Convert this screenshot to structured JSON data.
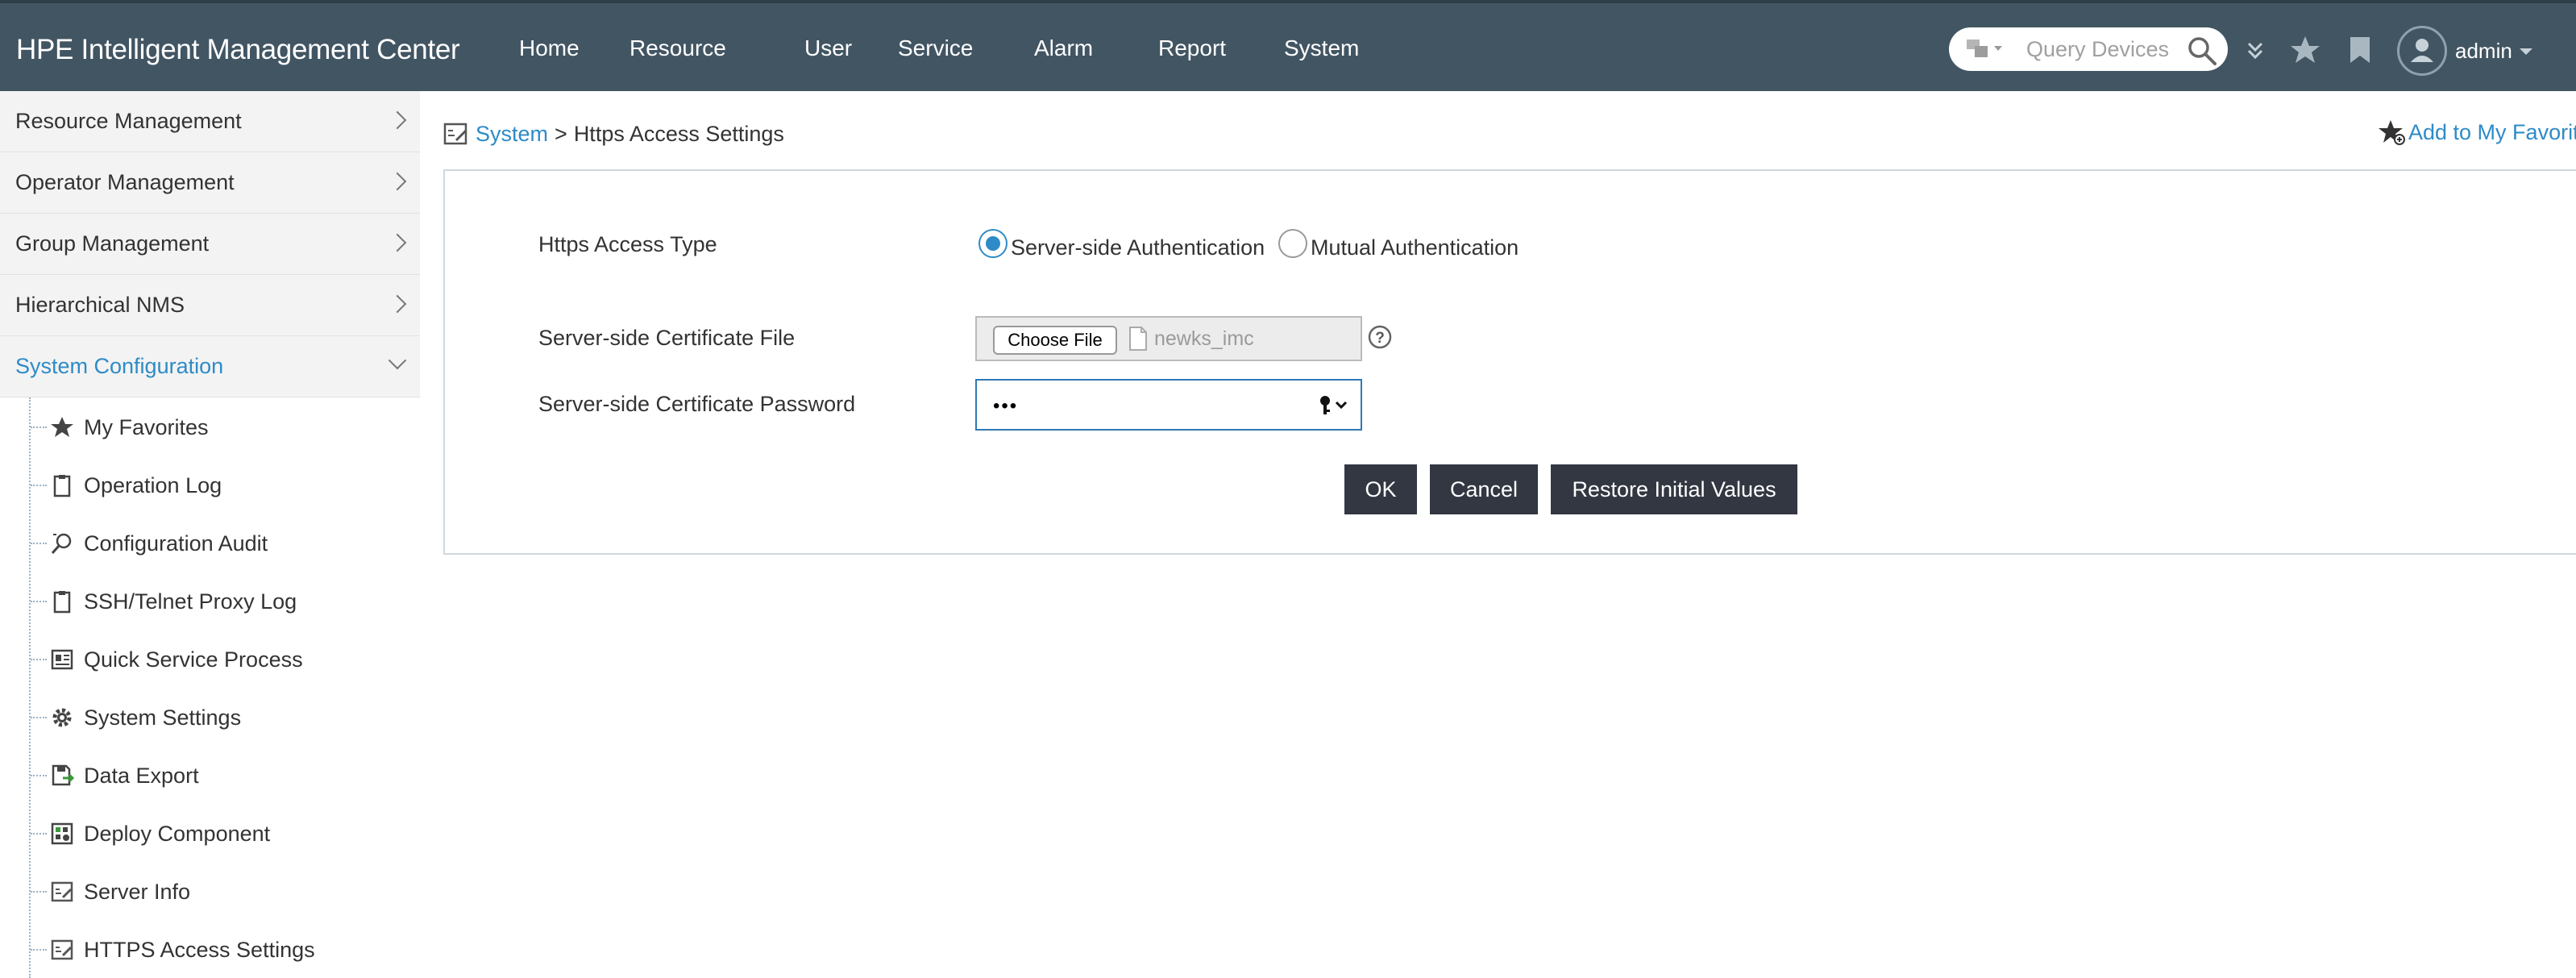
{
  "header": {
    "brand": "HPE Intelligent Management Center",
    "nav": [
      "Home",
      "Resource",
      "User",
      "Service",
      "Alarm",
      "Report",
      "System"
    ],
    "search_placeholder": "Query Devices",
    "user": "admin",
    "icons": [
      "devices-dropdown-icon",
      "search-icon",
      "double-chevron-down-icon",
      "star-icon",
      "bookmark-icon",
      "user-avatar-icon"
    ]
  },
  "sidebar": {
    "sections": [
      {
        "label": "Resource Management"
      },
      {
        "label": "Operator Management"
      },
      {
        "label": "Group Management"
      },
      {
        "label": "Hierarchical NMS"
      },
      {
        "label": "System Configuration"
      }
    ],
    "items": [
      {
        "label": "My Favorites",
        "icon": "star-icon"
      },
      {
        "label": "Operation Log",
        "icon": "clipboard-icon"
      },
      {
        "label": "Configuration Audit",
        "icon": "audit-magnifier-icon"
      },
      {
        "label": "SSH/Telnet Proxy Log",
        "icon": "clipboard-icon"
      },
      {
        "label": "Quick Service Process",
        "icon": "process-card-icon"
      },
      {
        "label": "System Settings",
        "icon": "gear-icon"
      },
      {
        "label": "Data Export",
        "icon": "export-icon"
      },
      {
        "label": "Deploy Component",
        "icon": "deploy-icon"
      },
      {
        "label": "Server Info",
        "icon": "server-info-icon"
      },
      {
        "label": "HTTPS Access Settings",
        "icon": "https-settings-icon"
      }
    ]
  },
  "breadcrumb": {
    "root": "System",
    "sep": ">",
    "current": "Https Access Settings"
  },
  "favorite_link": "Add to My Favorites",
  "form": {
    "access_type_label": "Https Access Type",
    "radio_server": "Server-side Authentication",
    "radio_mutual": "Mutual Authentication",
    "cert_file_label": "Server-side Certificate File",
    "choose_file": "Choose File",
    "file_name": "newks_imc",
    "cert_password_label": "Server-side Certificate Password",
    "password_mask": "•••"
  },
  "buttons": {
    "ok": "OK",
    "cancel": "Cancel",
    "restore": "Restore Initial Values"
  },
  "colors": {
    "header_bg": "#425563",
    "accent": "#2e8bc7",
    "button_bg": "#323741"
  }
}
